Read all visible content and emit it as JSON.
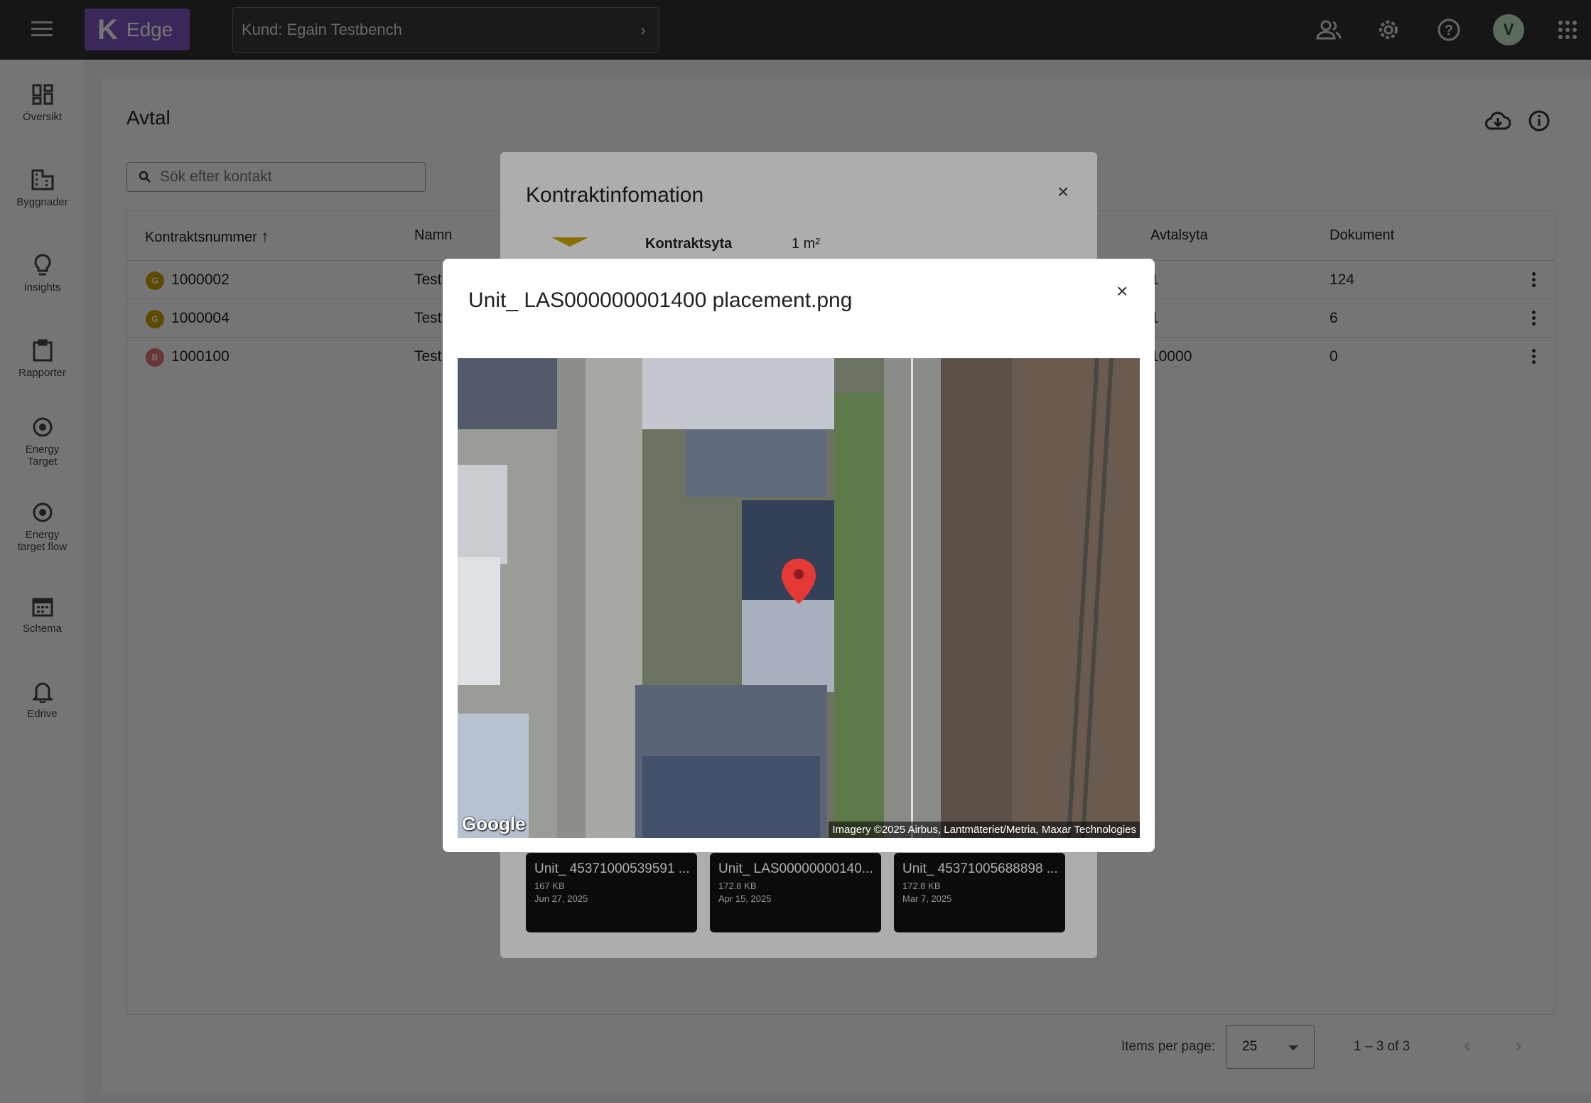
{
  "topbar": {
    "logo_letter": "K",
    "app_name": "Edge",
    "customer_label": "Kund: Egain Testbench",
    "avatar_initial": "V"
  },
  "sidebar": {
    "items": [
      {
        "label": "Översikt",
        "icon": "dashboard-icon"
      },
      {
        "label": "Byggnader",
        "icon": "building-icon"
      },
      {
        "label": "Insights",
        "icon": "lightbulb-icon"
      },
      {
        "label": "Rapporter",
        "icon": "clipboard-icon"
      },
      {
        "label": "Energy Target",
        "icon": "target-icon"
      },
      {
        "label": "Energy target flow",
        "icon": "target-icon"
      },
      {
        "label": "Schema",
        "icon": "calendar-icon"
      },
      {
        "label": "Edrive",
        "icon": "bell-icon"
      }
    ]
  },
  "page": {
    "title": "Avtal",
    "search_placeholder": "Sök efter kontakt"
  },
  "table": {
    "columns": [
      "Kontraktsnummer",
      "Namn",
      "Avtalsyta",
      "Dokument"
    ],
    "rows": [
      {
        "badge": "G",
        "badge_color": "#c9a400",
        "number": "1000002",
        "name": "Test",
        "area": "1",
        "docs": "124"
      },
      {
        "badge": "G",
        "badge_color": "#c9a400",
        "number": "1000004",
        "name": "Test",
        "area": "1",
        "docs": "6"
      },
      {
        "badge": "B",
        "badge_color": "#e57373",
        "number": "1000100",
        "name": "Test",
        "area": "10000",
        "docs": "0"
      }
    ]
  },
  "pager": {
    "label": "Items per page:",
    "page_size": "25",
    "range": "1 – 3 of 3"
  },
  "contract_dialog": {
    "title": "Kontraktinfomation",
    "area_label": "Kontraktsyta",
    "area_value": "1 m²",
    "files": [
      {
        "name": "Unit_ 45371000539591 ...",
        "size": "167 KB",
        "date": "Jun 27, 2025"
      },
      {
        "name": "Unit_ LAS00000000140...",
        "size": "172.8 KB",
        "date": "Apr 15, 2025"
      },
      {
        "name": "Unit_ 45371005688898 ...",
        "size": "172.8 KB",
        "date": "Mar 7, 2025"
      }
    ]
  },
  "image_dialog": {
    "title": "Unit_ LAS000000001400 placement.png",
    "map_logo": "Google",
    "map_credit": "Imagery ©2025 Airbus, Lantmäteriet/Metria, Maxar Technologies"
  },
  "colors": {
    "topbar": "#323232",
    "brand": "#7e57c2",
    "pin": "#e53935"
  }
}
